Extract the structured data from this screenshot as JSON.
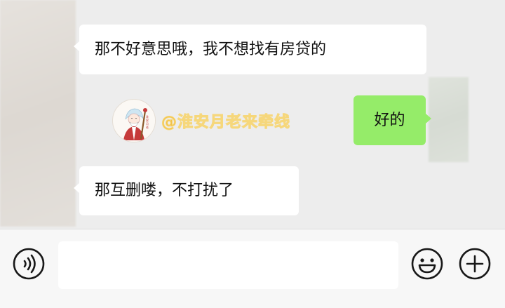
{
  "messages": [
    {
      "side": "left",
      "text": "那不好意思哦，我不想找有房贷的"
    },
    {
      "side": "right",
      "text": "好的"
    },
    {
      "side": "left",
      "text": "那互删喽，不打扰了"
    }
  ],
  "watermark": {
    "text": "@淮安月老来牵线",
    "color": "#f2c24a",
    "logo_text": "淮安月老"
  },
  "input_bar": {
    "voice_icon": "voice-icon",
    "emoji_icon": "emoji-icon",
    "plus_icon": "plus-icon",
    "input_value": ""
  },
  "colors": {
    "background": "#ededed",
    "incoming_bubble": "#ffffff",
    "outgoing_bubble": "#95ec69",
    "input_bar": "#f7f7f7"
  }
}
